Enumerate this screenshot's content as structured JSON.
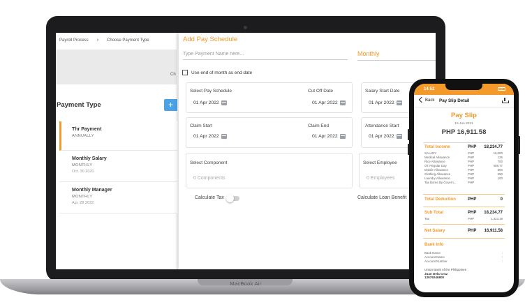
{
  "device": {
    "label": "MacBook Air"
  },
  "breadcrumb": {
    "items": [
      "Payroll Process",
      "Choose Payment Type"
    ]
  },
  "left_panel": {
    "banner_text": "Ch",
    "heading": "Payment Type",
    "add_label": "+",
    "items": [
      {
        "name": "Thr Payment",
        "frequency": "ANNUALLY",
        "date": ""
      },
      {
        "name": "Monthly Salary",
        "frequency": "MONTHLY",
        "date": "Oct. 30 2020"
      },
      {
        "name": "Monthly Manager",
        "frequency": "MONTHLY",
        "date": "Apr. 28 2022"
      }
    ]
  },
  "modal": {
    "title": "Add Pay Schedule",
    "name_placeholder": "Type Payment Name here...",
    "frequency": "Monthly",
    "eom_label": "Use end of month as end date",
    "select_schedule_label": "Select Pay Schedule",
    "select_schedule_value": "01 Apr 2022",
    "cutoff_label": "Cut Off Date",
    "cutoff_value": "01 Apr 2022",
    "salary_start_label": "Salary Start Date",
    "salary_start_value": "01 Apr 2022",
    "claim_start_label": "Claim Start",
    "claim_start_value": "01 Apr 2022",
    "claim_end_label": "Claim End",
    "claim_end_value": "01 Apr 2022",
    "attendance_start_label": "Attendance Start",
    "attendance_start_value": "01 Apr 2022",
    "select_component_label": "Select Component",
    "select_component_value": "0 Components",
    "select_employee_label": "Select Employee",
    "select_employee_value": "0 Employees",
    "calc_tax_label": "Calculate Tax",
    "calc_tax_on": false,
    "calc_loan_label": "Calculate Loan Benefit"
  },
  "phone": {
    "time": "14:52",
    "back_label": "Back",
    "nav_title": "Pay Slip Detail",
    "title": "Pay Slip",
    "date": "15 Jun 2021",
    "total": "PHP 16,911.58",
    "total_income": {
      "label": "Total Income",
      "currency": "PHP",
      "amount": "18,234.77"
    },
    "income_rows": [
      {
        "name": "SALARY",
        "currency": "PHP",
        "amount": "16,000"
      },
      {
        "name": "Medical Allowance",
        "currency": "PHP",
        "amount": "125"
      },
      {
        "name": "Rice Allowance",
        "currency": "PHP",
        "amount": "700"
      },
      {
        "name": "OT Regular Day",
        "currency": "PHP",
        "amount": "409.77"
      },
      {
        "name": "Mobile Allowance",
        "currency": "PHP",
        "amount": "500"
      },
      {
        "name": "Clothing Allowance",
        "currency": "PHP",
        "amount": "250"
      },
      {
        "name": "Laundry Allowance",
        "currency": "PHP",
        "amount": "100"
      },
      {
        "name": "Tax Borne By Govern...",
        "currency": "PHP",
        "amount": ""
      }
    ],
    "total_deduction": {
      "label": "Total Deduction",
      "currency": "PHP",
      "amount": "0"
    },
    "sub_total": {
      "label": "Sub Total",
      "currency": "PHP",
      "amount": "18,234.77"
    },
    "tax_row": {
      "name": "Tax",
      "currency": "PHP",
      "amount": "1,323.19"
    },
    "net_salary": {
      "label": "Net Salary",
      "currency": "PHP",
      "amount": "16,911.58"
    },
    "bank_title": "Bank Info",
    "bank_rows": [
      {
        "name": "Bank Name",
        "value": ":"
      },
      {
        "name": "Account Name",
        "value": ":"
      },
      {
        "name": "Account Number",
        "value": ":"
      }
    ],
    "bank_name": "Union Bank of the Philippines",
    "account_name": "Juan Dela Cruz",
    "account_number": "13579246800"
  },
  "colors": {
    "accent": "#f39a2b",
    "add_button": "#4aa3e8",
    "device": "#1c1c1e"
  }
}
